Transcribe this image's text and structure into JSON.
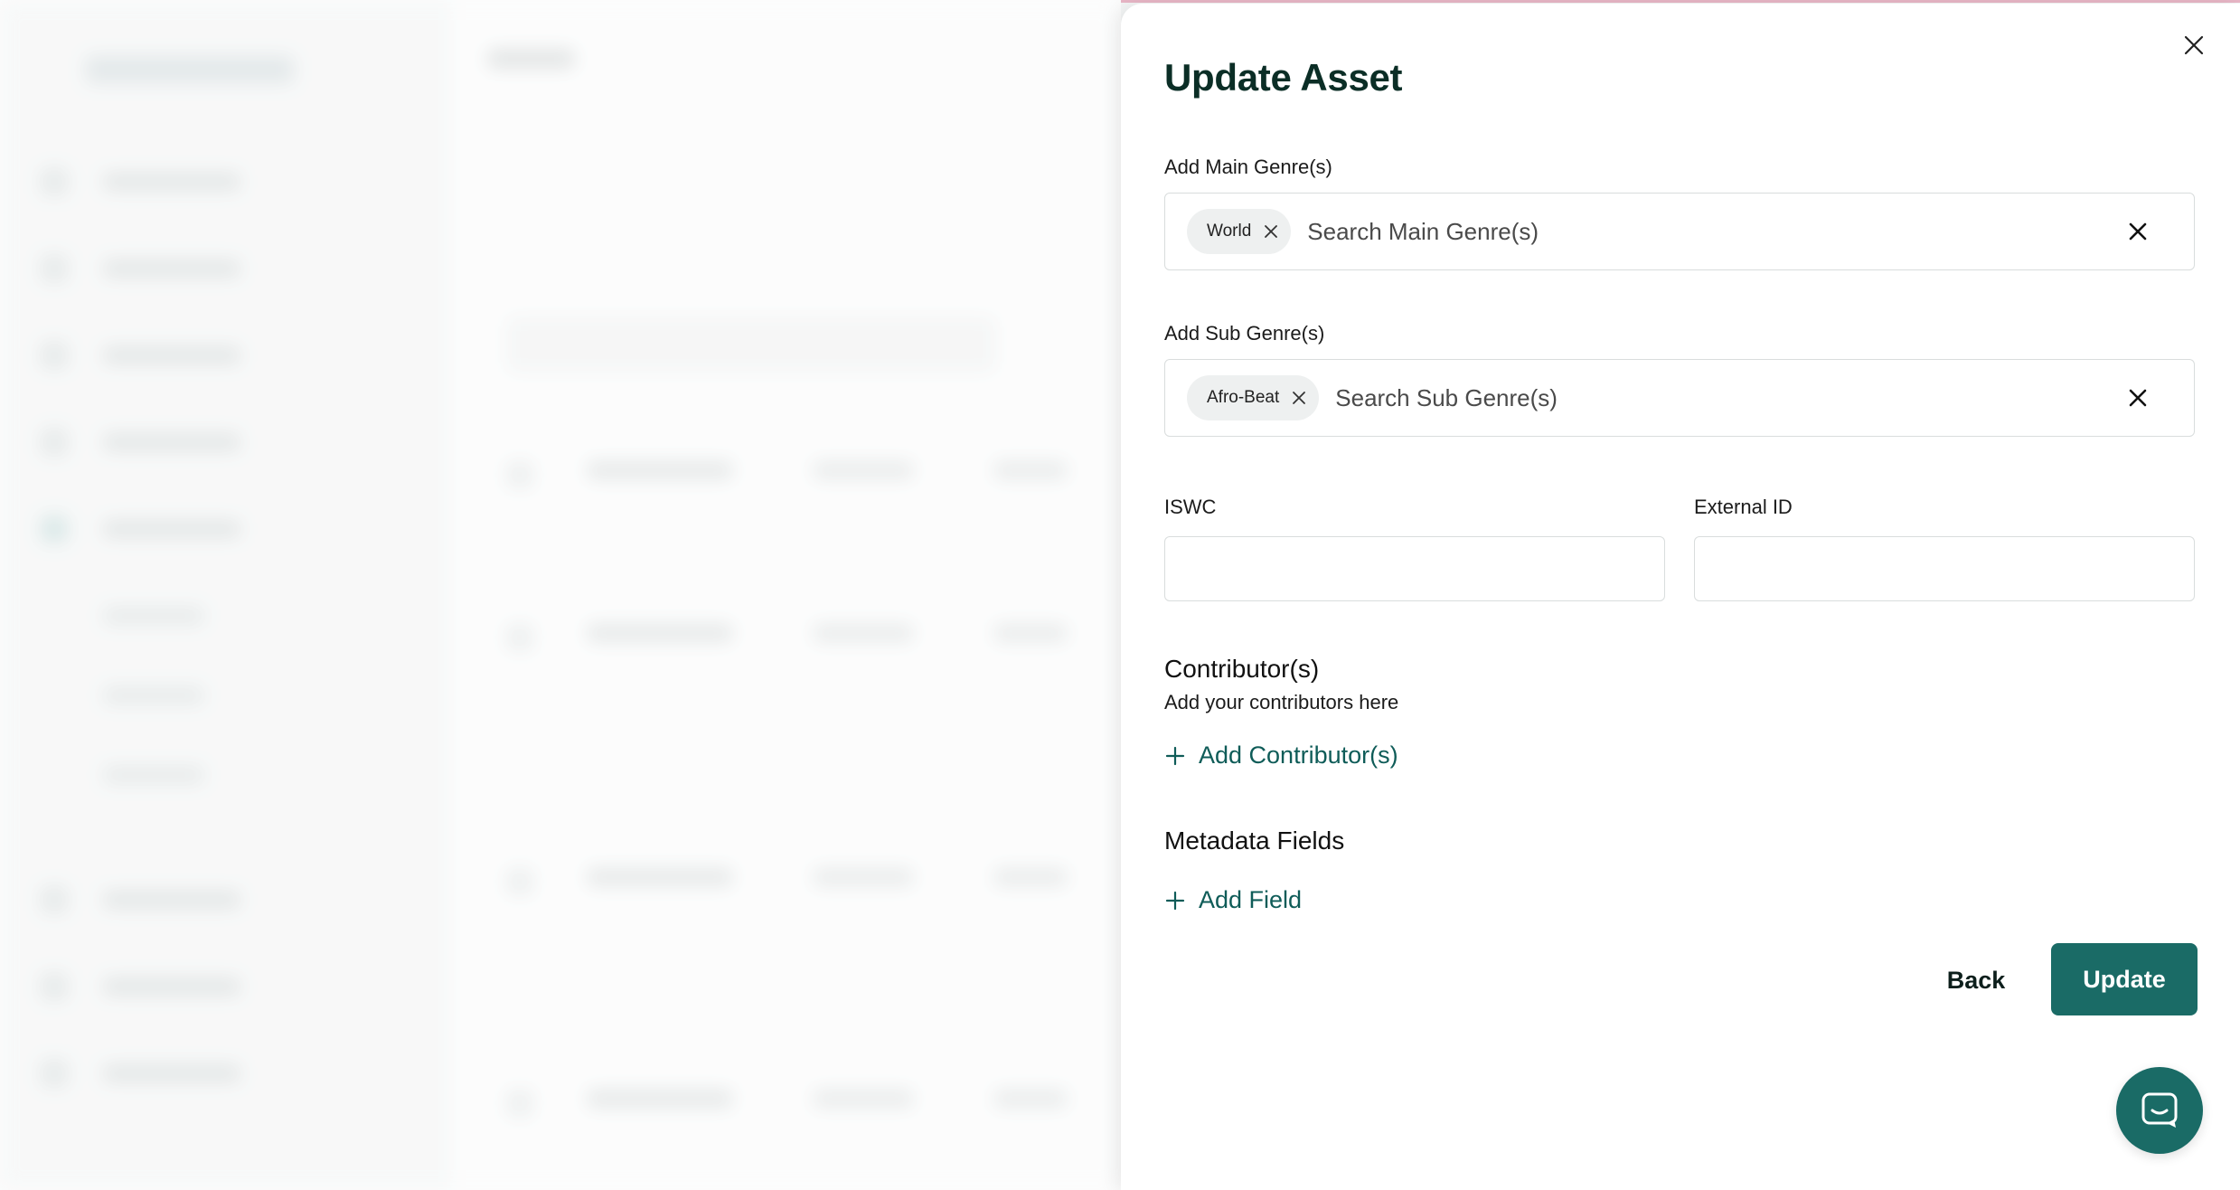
{
  "drawer": {
    "title": "Update Asset",
    "main_genre": {
      "label": "Add Main Genre(s)",
      "chips": [
        "World"
      ],
      "placeholder": "Search Main Genre(s)"
    },
    "sub_genre": {
      "label": "Add Sub Genre(s)",
      "chips": [
        "Afro-Beat"
      ],
      "placeholder": "Search Sub Genre(s)"
    },
    "iswc": {
      "label": "ISWC",
      "value": ""
    },
    "external_id": {
      "label": "External ID",
      "value": ""
    },
    "contributors": {
      "title": "Contributor(s)",
      "subtitle": "Add your contributors here",
      "add_label": "Add Contributor(s)"
    },
    "metadata": {
      "title": "Metadata Fields",
      "add_label": "Add Field"
    },
    "actions": {
      "back_label": "Back",
      "update_label": "Update"
    }
  },
  "colors": {
    "title": "#0b2e26",
    "accent": "#1a6b66",
    "link": "#0f5c58",
    "border": "#d9dddd",
    "chip_bg": "#eef0f0"
  },
  "icons": {
    "close": "close-icon",
    "chip_remove": "x-icon",
    "clear": "clear-icon",
    "add": "plus-icon",
    "chat": "chat-icon"
  }
}
